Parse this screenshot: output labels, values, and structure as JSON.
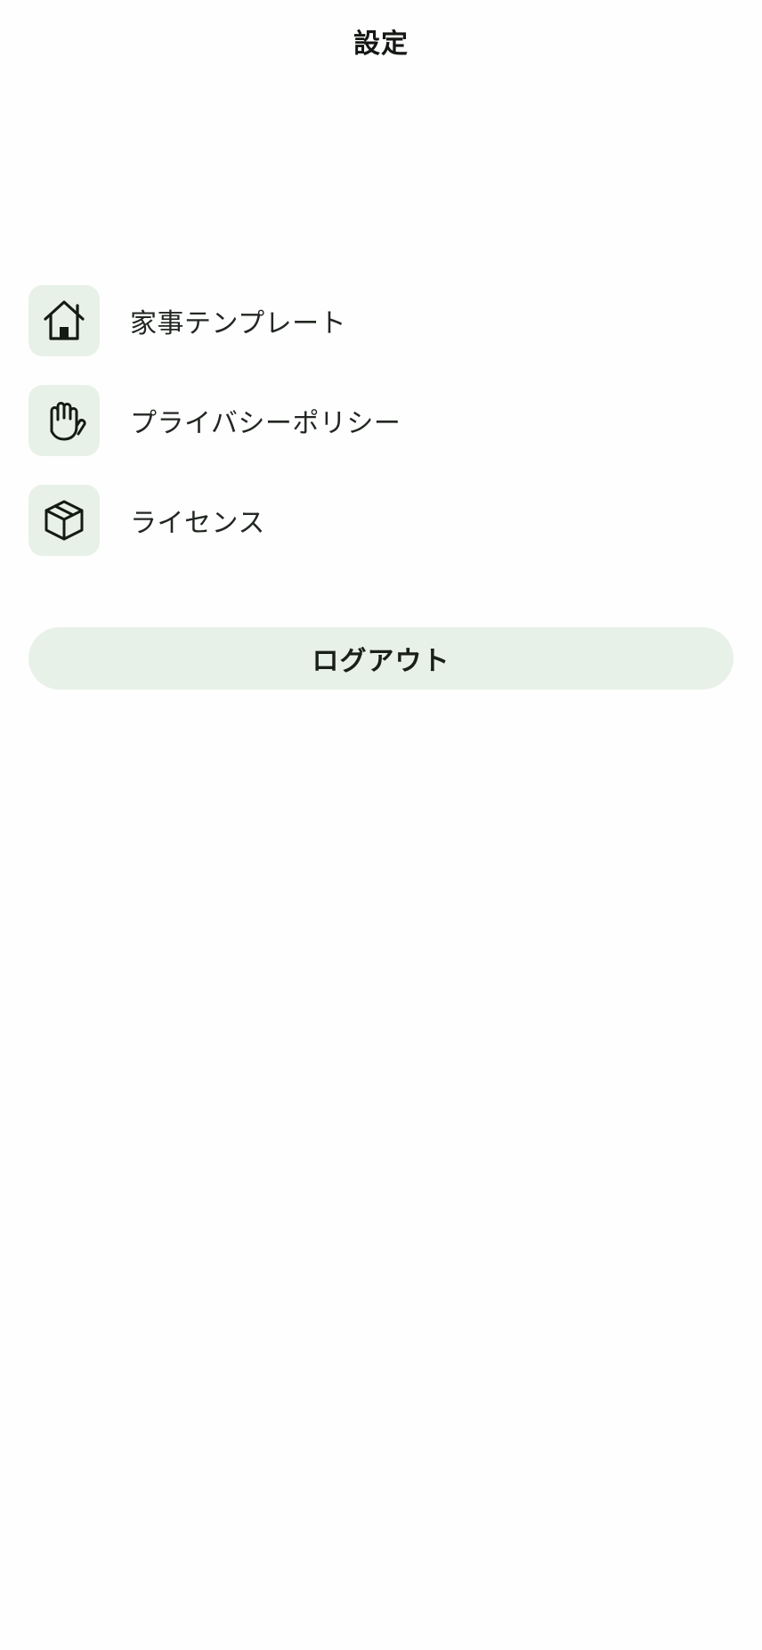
{
  "header": {
    "title": "設定"
  },
  "menu": {
    "items": [
      {
        "label": "家事テンプレート",
        "icon": "house-icon"
      },
      {
        "label": "プライバシーポリシー",
        "icon": "hand-icon"
      },
      {
        "label": "ライセンス",
        "icon": "package-icon"
      }
    ]
  },
  "logout": {
    "label": "ログアウト"
  },
  "colors": {
    "accent_background": "#e8f1e8",
    "text": "#1a1f1a",
    "background": "#fefefe"
  }
}
